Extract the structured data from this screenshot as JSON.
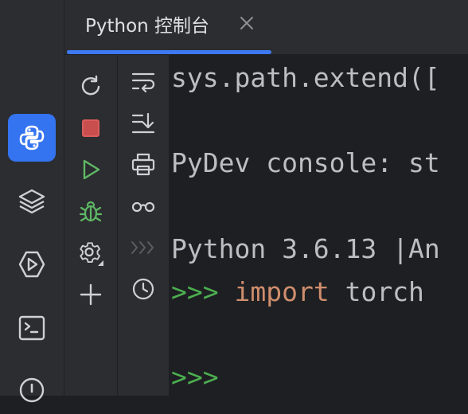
{
  "activity_bar": {
    "items": [
      {
        "name": "python-console",
        "icon": "python-icon",
        "active": true
      },
      {
        "name": "layers",
        "icon": "layers-icon",
        "active": false
      },
      {
        "name": "services",
        "icon": "services-icon",
        "active": false
      },
      {
        "name": "terminal",
        "icon": "terminal-icon",
        "active": false
      },
      {
        "name": "problems",
        "icon": "problems-icon",
        "active": false
      }
    ]
  },
  "tab": {
    "label": "Python 控制台",
    "close_icon": "close-icon"
  },
  "toolbar_left": [
    {
      "name": "rerun",
      "icon": "rerun-icon",
      "color": "#ced0d6"
    },
    {
      "name": "stop",
      "icon": "stop-icon",
      "color": "#db5c5c"
    },
    {
      "name": "run",
      "icon": "run-icon",
      "color": "#5fb865"
    },
    {
      "name": "debug",
      "icon": "debug-icon",
      "color": "#5fb865"
    },
    {
      "name": "settings",
      "icon": "gear-icon",
      "color": "#ced0d6"
    },
    {
      "name": "new-console",
      "icon": "plus-icon",
      "color": "#ced0d6"
    }
  ],
  "toolbar_right": [
    {
      "name": "soft-wrap",
      "icon": "soft-wrap-icon"
    },
    {
      "name": "scroll-to-end",
      "icon": "scroll-to-end-icon"
    },
    {
      "name": "print",
      "icon": "print-icon"
    },
    {
      "name": "show-variables",
      "icon": "glasses-icon"
    },
    {
      "name": "execute-in-console",
      "icon": "chevrons-right-icon",
      "disabled": true
    },
    {
      "name": "history",
      "icon": "clock-icon"
    }
  ],
  "console": {
    "line1": "sys.path.extend([",
    "line2": "PyDev console: st",
    "line3": "Python 3.6.13 |An",
    "prompt1": ">>>",
    "keyword_import": "import",
    "module_torch": "torch",
    "prompt2": ">>>"
  },
  "colors": {
    "background": "#1e1f22",
    "panel": "#2b2d30",
    "accent": "#3574f0",
    "prompt": "#4caf50",
    "keyword": "#cf8e6d",
    "text": "#bcbec4"
  }
}
